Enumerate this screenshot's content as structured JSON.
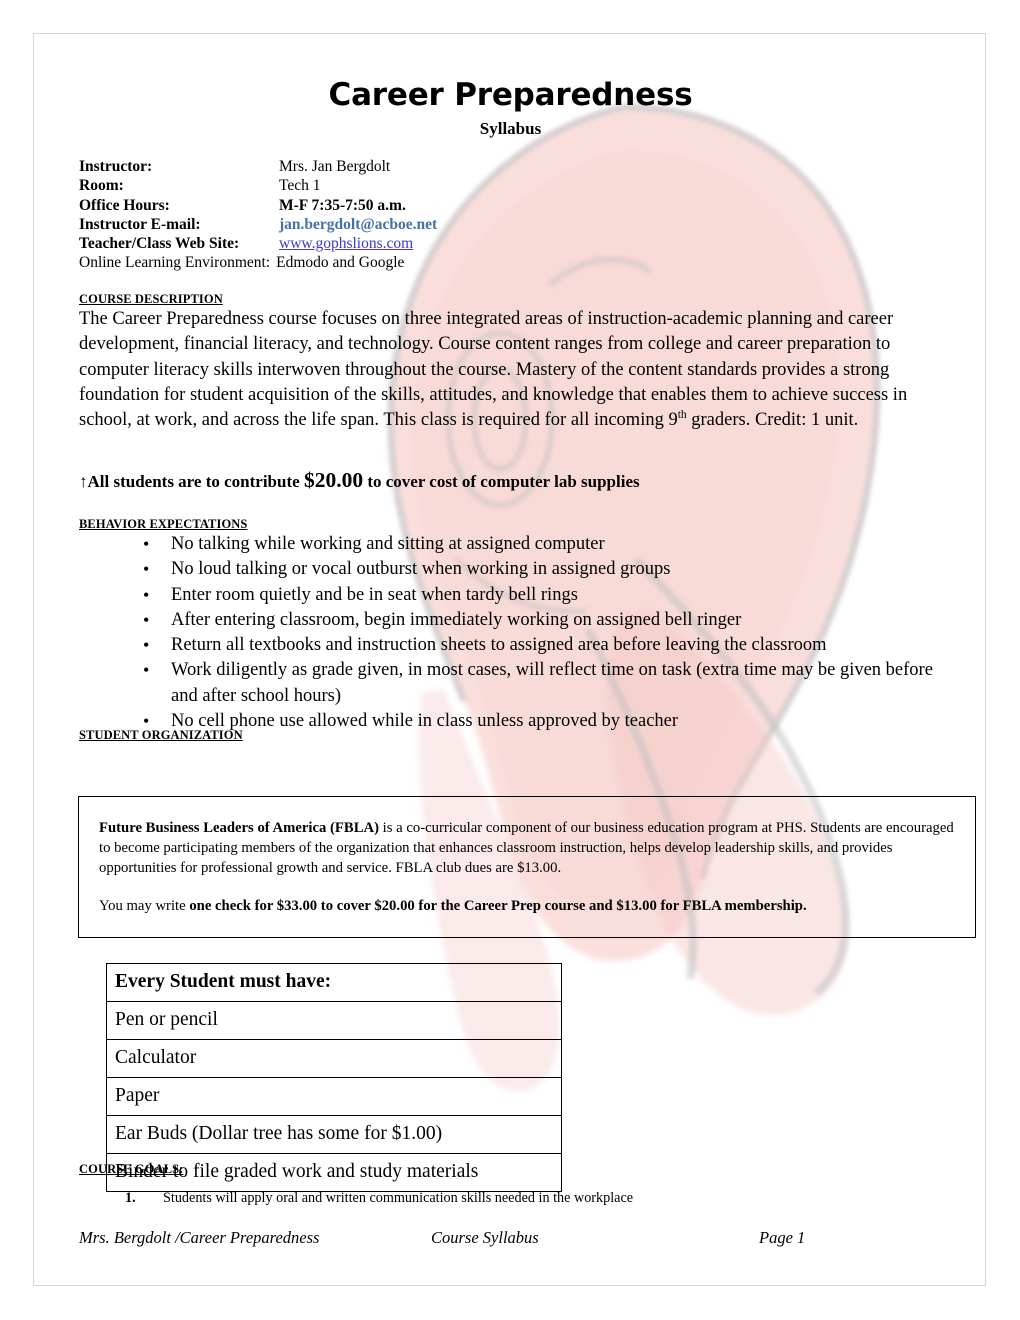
{
  "header": {
    "title": "Career Preparedness",
    "subtitle": "Syllabus"
  },
  "info": {
    "rows": [
      {
        "label": "Instructor:",
        "value": "Mrs. Jan Bergdolt",
        "style": "plain"
      },
      {
        "label": "Room:",
        "value": "Tech 1",
        "style": "plain"
      },
      {
        "label": "Office Hours:",
        "value": "M-F 7:35-7:50 a.m.",
        "style": "bold"
      },
      {
        "label": "Instructor E-mail:",
        "value": "jan.bergdolt@acboe.net",
        "style": "email"
      },
      {
        "label": "Teacher/Class Web Site:",
        "value": "www.gophslions.com",
        "style": "weblink"
      }
    ],
    "online_label": "Online Learning Environment:",
    "online_value": "Edmodo and Google",
    "email_color": "#4472a8",
    "link_color": "#3b3bc4"
  },
  "course_description": {
    "heading": "COURSE DESCRIPTION",
    "text_before_sup": "The Career Preparedness course focuses on three integrated areas of instruction-academic planning and career development, financial literacy, and technology. Course content ranges from college and career preparation to computer literacy skills interwoven throughout the course. Mastery of the content standards provides a strong foundation for student acquisition of the skills, attitudes, and knowledge that enables them to achieve success in school, at work, and across the life span. This class is required for all incoming 9",
    "superscript": "th",
    "text_after_sup": " graders. Credit: 1 unit."
  },
  "contribution": {
    "arrow": "↑",
    "text_before_amount": "All students are to contribute ",
    "amount": "$20.00",
    "text_after_amount": " to cover cost of computer lab supplies"
  },
  "behavior": {
    "heading": "BEHAVIOR EXPECTATIONS",
    "bullet_glyph": "•",
    "items": [
      "No talking while working and sitting at assigned computer",
      "No loud talking or vocal outburst when working in assigned groups",
      "Enter room quietly and be in seat when tardy bell rings",
      "After entering classroom, begin immediately working on assigned bell ringer",
      "Return all textbooks and instruction sheets to assigned area before leaving the classroom",
      "Work diligently as grade given, in most cases, will reflect time on task (extra time may be given before and after school hours)",
      "No cell phone use allowed while in class unless approved by teacher"
    ]
  },
  "student_organization": {
    "heading": "STUDENT ORGANIZATION",
    "box": {
      "para1_bold": "Future Business Leaders of America (FBLA)",
      "para1_rest": " is a co-curricular component of our business education program at PHS. Students are encouraged to become participating members of the organization that enhances classroom instruction, helps develop leadership skills, and provides opportunities for professional growth and service. FBLA club dues are $13.00.",
      "para2_lead": "You may write ",
      "para2_bold": "one check for $33.00 to cover $20.00 for the Career Prep course and $13.00 for FBLA membership."
    }
  },
  "supplies": {
    "header": "Every Student must have:",
    "items": [
      "Pen or pencil",
      "Calculator",
      "Paper",
      "Ear Buds (Dollar tree has some for $1.00)",
      "Binder to file graded work and study materials"
    ]
  },
  "course_goals": {
    "heading": "COURSE GOALS:",
    "items": [
      {
        "number": "1.",
        "text": "Students will apply oral and written communication skills needed in the workplace"
      }
    ]
  },
  "footer": {
    "left": "Mrs. Bergdolt /Career Preparedness",
    "center": "Course Syllabus",
    "right": "Page 1"
  }
}
